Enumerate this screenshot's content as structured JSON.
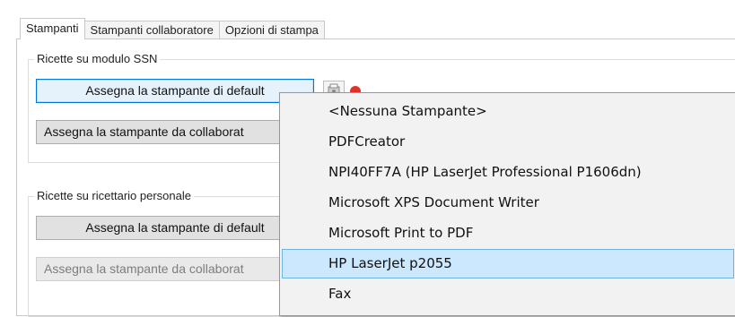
{
  "tabs": [
    {
      "label": "Stampanti",
      "active": true
    },
    {
      "label": "Stampanti collaboratore",
      "active": false
    },
    {
      "label": "Opzioni di stampa",
      "active": false
    }
  ],
  "group_ssn": {
    "title": "Ricette su modulo SSN",
    "default_button": "Assegna la stampante di default",
    "collab_button": "Assegna la stampante da collaborat"
  },
  "group_personal": {
    "title": "Ricette su ricettario personale",
    "default_button": "Assegna la stampante di default",
    "collab_button": "Assegna la stampante da collaborat"
  },
  "icons": {
    "printer_settings": "printer-gear-icon",
    "status": "red-status-dot-icon"
  },
  "colors": {
    "accent": "#0078d7",
    "selection": "#cce8ff",
    "status_red": "#e0322b"
  },
  "printer_menu": {
    "items": [
      "<Nessuna Stampante>",
      "PDFCreator",
      "NPI40FF7A (HP LaserJet Professional P1606dn)",
      "Microsoft XPS Document Writer",
      "Microsoft Print to PDF",
      "HP LaserJet p2055",
      "Fax"
    ],
    "selected": "HP LaserJet p2055"
  }
}
